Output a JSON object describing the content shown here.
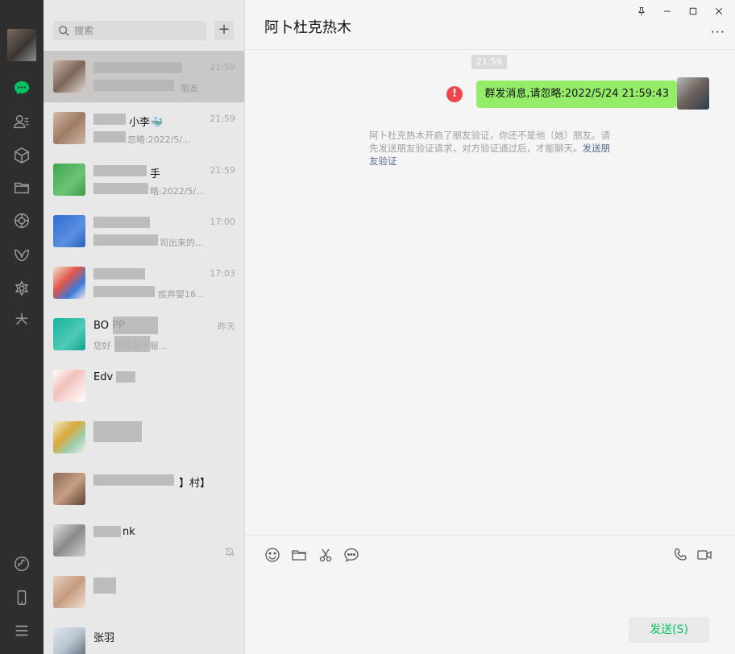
{
  "nav": {
    "items": [
      {
        "name": "chat-nav",
        "icon": "chat-bubble-icon",
        "active": true
      },
      {
        "name": "contacts-nav",
        "icon": "contacts-icon"
      },
      {
        "name": "favorites-nav",
        "icon": "cube-icon"
      },
      {
        "name": "files-nav",
        "icon": "folder-icon"
      },
      {
        "name": "moments-nav",
        "icon": "aperture-icon"
      },
      {
        "name": "channels-nav",
        "icon": "butterfly-icon"
      },
      {
        "name": "search-nav",
        "icon": "settings-flower-icon"
      },
      {
        "name": "mini-programs-nav",
        "icon": "sparkle-icon"
      }
    ],
    "bottom": [
      {
        "name": "mini-program-nav",
        "icon": "mini-program-icon"
      },
      {
        "name": "phone-nav",
        "icon": "phone-device-icon"
      },
      {
        "name": "menu-nav",
        "icon": "hamburger-icon"
      }
    ],
    "accent": "#07c160"
  },
  "search": {
    "placeholder": "搜索",
    "add_label": "+"
  },
  "conversations": [
    {
      "name": "",
      "preview": "朋友",
      "time": "21:59",
      "active": true
    },
    {
      "name": "小李🐳",
      "preview": "忽略:2022/5/...",
      "time": "21:59"
    },
    {
      "name": "手",
      "preview": "略:2022/5/...",
      "time": "21:59"
    },
    {
      "name": "",
      "preview": "司出来的...",
      "time": "17:00"
    },
    {
      "name": "",
      "preview": "疾弃婴16...",
      "time": "17:03"
    },
    {
      "name": "BO PP",
      "preview": "您好 选择以下服...",
      "time": "昨天"
    },
    {
      "name": "Edv",
      "preview": "",
      "time": ""
    },
    {
      "name": "",
      "preview": "",
      "time": ""
    },
    {
      "name": "】村】",
      "preview": "",
      "time": ""
    },
    {
      "name": "nk",
      "preview": "",
      "time": "",
      "muted": true
    },
    {
      "name": "",
      "preview": "",
      "time": ""
    },
    {
      "name": "张羽",
      "preview": "",
      "time": ""
    }
  ],
  "chat": {
    "title": "阿卜杜克热木",
    "time_chip": "21:59",
    "message": "群发消息,请忽略:2022/5/24 21:59:43",
    "system_text": "阿卜杜克热木开启了朋友验证，你还不是他（她）朋友。请先发送朋友验证请求，对方验证通过后，才能聊天。",
    "system_link": "发送朋友验证",
    "more_label": "···",
    "send_label": "发送(S)",
    "error_mark": "!"
  },
  "colors": {
    "bubble": "#95ec69",
    "error": "#f2474a",
    "link": "#576b95"
  }
}
